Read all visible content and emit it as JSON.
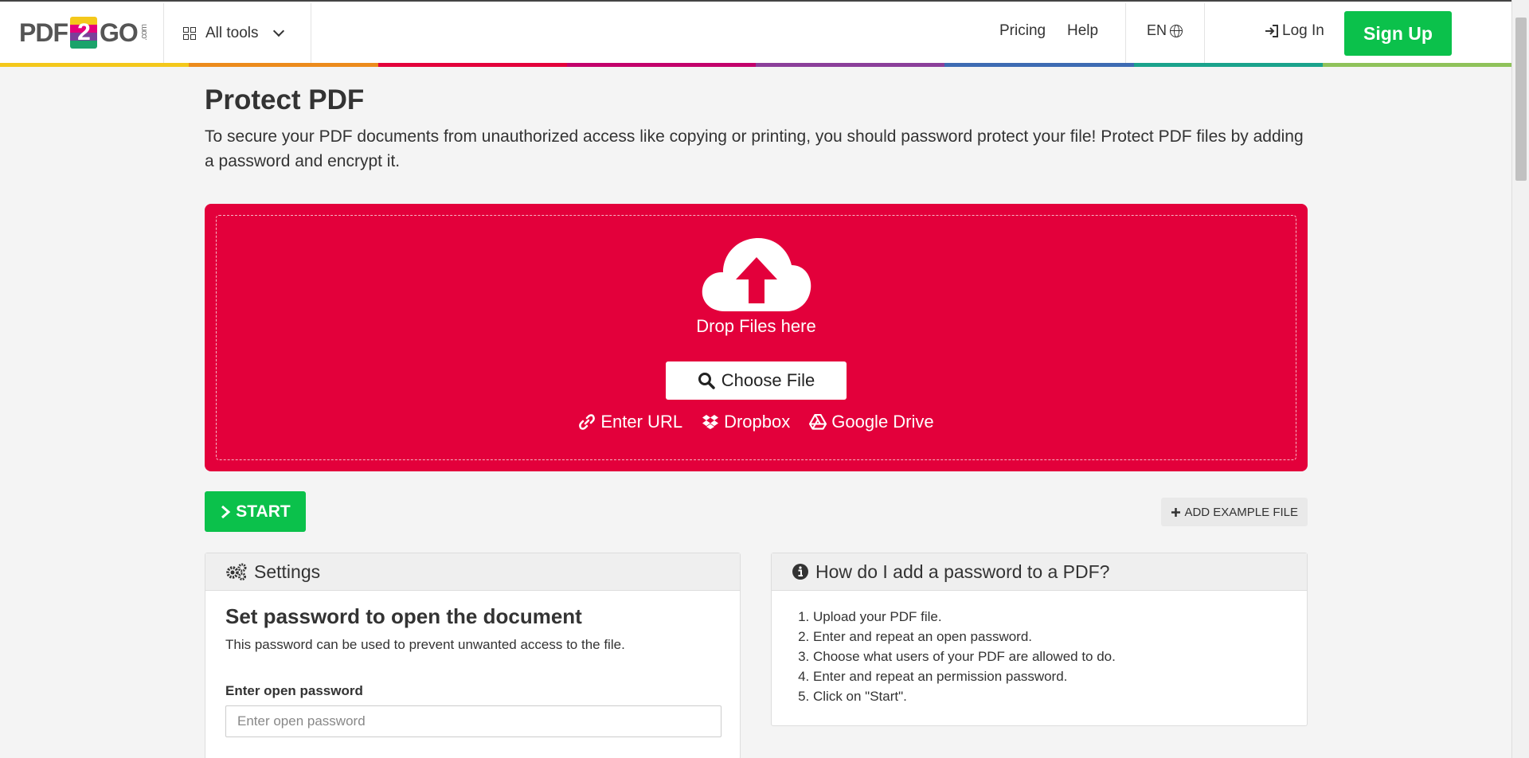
{
  "header": {
    "logo_left": "PDF",
    "logo_num": "2",
    "logo_right": "GO",
    "logo_com": ".com",
    "all_tools": "All tools",
    "pricing": "Pricing",
    "help": "Help",
    "lang": "EN",
    "login": "Log In",
    "signup": "Sign Up",
    "rainbow_colors": [
      "#f4c81b",
      "#ec8b1c",
      "#e3003b",
      "#c3006b",
      "#8b3f9a",
      "#3d6bb3",
      "#1aa38c",
      "#8fc25a"
    ]
  },
  "page": {
    "title": "Protect PDF",
    "description": "To secure your PDF documents from unauthorized access like copying or printing, you should password protect your file! Protect PDF files by adding a password and encrypt it."
  },
  "dropzone": {
    "drop_text": "Drop Files here",
    "choose_file": "Choose File",
    "enter_url": "Enter URL",
    "dropbox": "Dropbox",
    "google_drive": "Google Drive",
    "color": "#e3003b"
  },
  "actions": {
    "start": "START",
    "add_example": "ADD EXAMPLE FILE"
  },
  "settings": {
    "header": "Settings",
    "title": "Set password to open the document",
    "description": "This password can be used to prevent unwanted access to the file.",
    "field_label": "Enter open password",
    "field_placeholder": "Enter open password"
  },
  "howto": {
    "header": "How do I add a password to a PDF?",
    "steps": [
      "Upload your PDF file.",
      "Enter and repeat an open password.",
      "Choose what users of your PDF are allowed to do.",
      "Enter and repeat an permission password.",
      "Click on \"Start\"."
    ]
  }
}
